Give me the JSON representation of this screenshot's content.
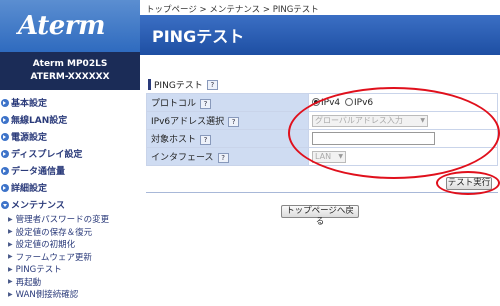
{
  "brand": {
    "logo": "Aterm",
    "model_line1": "Aterm   MP02LS",
    "model_line2": "ATERM-XXXXXX"
  },
  "sidebar": {
    "items": [
      {
        "label": "基本設定"
      },
      {
        "label": "無線LAN設定"
      },
      {
        "label": "電源設定"
      },
      {
        "label": "ディスプレイ設定"
      },
      {
        "label": "データ通信量"
      },
      {
        "label": "詳細設定"
      },
      {
        "label": "メンテナンス"
      }
    ],
    "subitems": [
      {
        "label": "管理者パスワードの変更"
      },
      {
        "label": "設定値の保存＆復元"
      },
      {
        "label": "設定値の初期化"
      },
      {
        "label": "ファームウェア更新"
      },
      {
        "label": "PINGテスト"
      },
      {
        "label": "再起動"
      },
      {
        "label": "WAN側接続確認"
      }
    ]
  },
  "breadcrumb": "トップページ > メンテナンス > PINGテスト",
  "page_title": "PINGテスト",
  "section": {
    "title": "PINGテスト",
    "help": "?"
  },
  "form": {
    "protocol_label": "プロトコル",
    "ipv4": "IPv4",
    "ipv6": "IPv6",
    "ipv6_select_label": "IPv6アドレス選択",
    "ipv6_select_value": "グローバルアドレス入力",
    "host_label": "対象ホスト",
    "host_value": "",
    "interface_label": "インタフェース",
    "interface_value": "LAN",
    "help": "?"
  },
  "buttons": {
    "test": "テスト実行",
    "back": "トップページへ戻る"
  },
  "colors": {
    "title_bar": "#2a5db5",
    "label_bg": "#cfdcf2",
    "highlight": "#e0101c"
  }
}
